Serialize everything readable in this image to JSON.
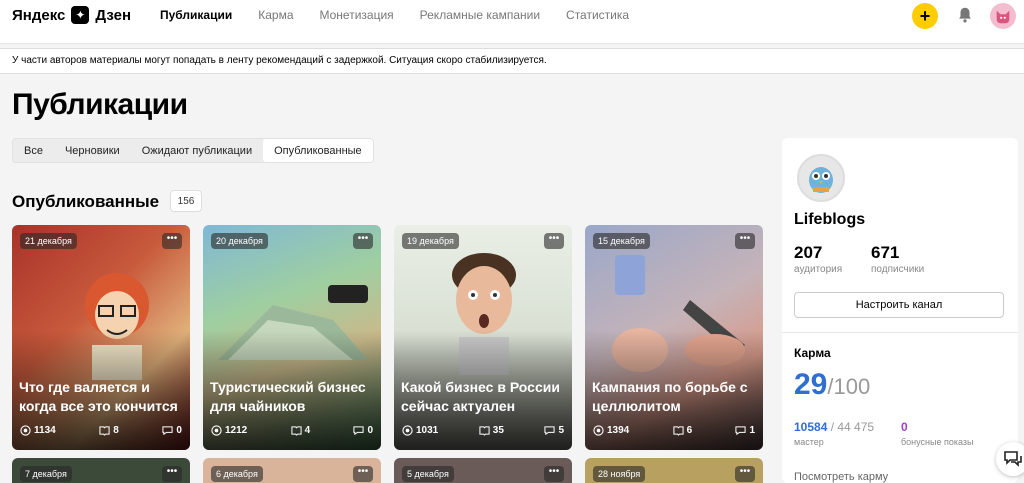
{
  "header": {
    "logo_left": "Яндекс",
    "logo_right": "Дзен",
    "nav": [
      "Публикации",
      "Карма",
      "Монетизация",
      "Рекламные кампании",
      "Статистика"
    ],
    "add_label": "+"
  },
  "notice": "У части авторов материалы могут попадать в ленту рекомендаций с задержкой. Ситуация скоро стабилизируется.",
  "page_title": "Публикации",
  "tabs": [
    "Все",
    "Черновики",
    "Ожидают публикации",
    "Опубликованные"
  ],
  "section": {
    "title": "Опубликованные",
    "count": "156"
  },
  "cards": [
    {
      "date": "21 декабря",
      "title": "Что где валяется и когда все это кончится",
      "views": "1134",
      "reads": "8",
      "comments": "0"
    },
    {
      "date": "20 декабря",
      "title": "Туристический бизнес для чайников",
      "views": "1212",
      "reads": "4",
      "comments": "0"
    },
    {
      "date": "19 декабря",
      "title": "Какой бизнес в России сейчас актуален",
      "views": "1031",
      "reads": "35",
      "comments": "5"
    },
    {
      "date": "15 декабря",
      "title": "Кампания по борьбе с целлюлитом",
      "views": "1394",
      "reads": "6",
      "comments": "1"
    }
  ],
  "cards_row2": [
    {
      "date": "7 декабря"
    },
    {
      "date": "6 декабря"
    },
    {
      "date": "5 декабря"
    },
    {
      "date": "28 ноября"
    }
  ],
  "sidebar": {
    "channel_name": "Lifeblogs",
    "audience_value": "207",
    "audience_label": "аудитория",
    "subscribers_value": "671",
    "subscribers_label": "подписчики",
    "settings_button": "Настроить канал",
    "karma_title": "Карма",
    "karma_value": "29",
    "karma_max": "/100",
    "master_value": "10584",
    "master_total": " / 44 475",
    "master_label": "мастер",
    "bonus_value": "0",
    "bonus_label": "бонусные показы",
    "karma_link": "Посмотреть карму"
  },
  "colors": {
    "accent_yellow": "#ffcc00",
    "karma_blue": "#2e6fd1",
    "bonus_purple": "#a03ec8"
  }
}
